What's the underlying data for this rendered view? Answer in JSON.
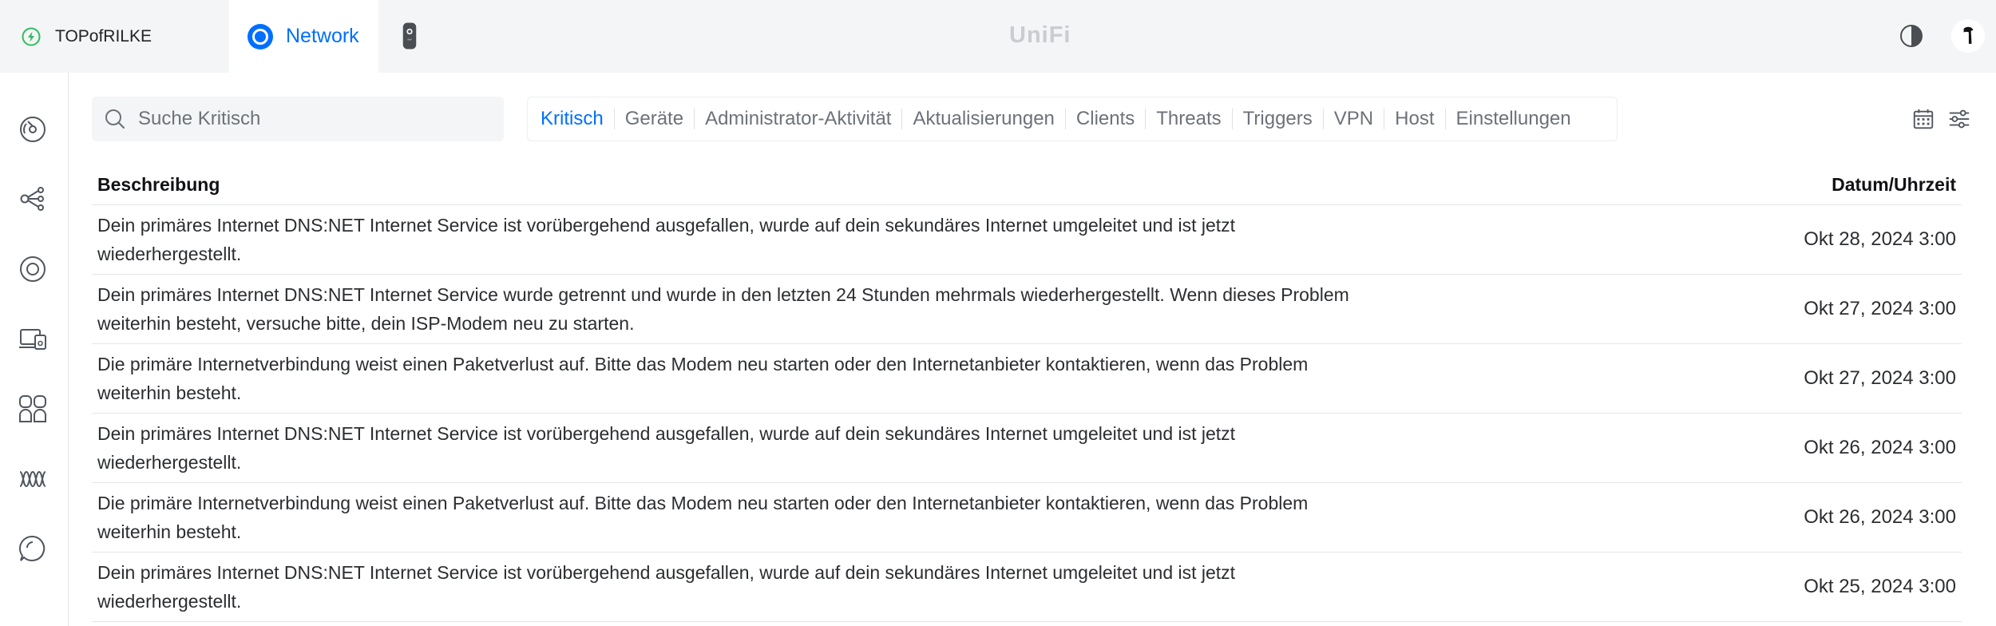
{
  "topbar": {
    "site_name": "TOPofRILKE",
    "app_name": "Network",
    "brand": "UniFi",
    "site_icon": "lightning-circle-icon",
    "app_icon": "network-ring-icon",
    "device_icon": "device-icon",
    "theme_icon": "half-circle-theme-icon",
    "avatar_icon": "user-avatar-icon"
  },
  "sidebar": {
    "items": [
      {
        "icon": "dashboard-icon"
      },
      {
        "icon": "topology-icon"
      },
      {
        "icon": "wifi-icon"
      },
      {
        "icon": "devices-icon"
      },
      {
        "icon": "clients-icon"
      },
      {
        "icon": "insights-icon"
      },
      {
        "icon": "integrations-icon"
      }
    ]
  },
  "toolbar": {
    "search_placeholder": "Suche Kritisch",
    "filters": [
      "Kritisch",
      "Geräte",
      "Administrator-Aktivität",
      "Aktualisierungen",
      "Clients",
      "Threats",
      "Triggers",
      "VPN",
      "Host",
      "Einstellungen"
    ],
    "active_filter": "Kritisch",
    "calendar_icon": "calendar-icon",
    "settings_icon": "sliders-icon"
  },
  "table": {
    "headers": {
      "description": "Beschreibung",
      "datetime": "Datum/Uhrzeit"
    },
    "rows": [
      {
        "description": "Dein primäres Internet DNS:NET Internet Service ist vorübergehend ausgefallen, wurde auf dein sekundäres Internet umgeleitet und ist jetzt wiederhergestellt.",
        "datetime": "Okt 28, 2024 3:00"
      },
      {
        "description": "Dein primäres Internet DNS:NET Internet Service wurde getrennt und wurde in den letzten 24 Stunden mehrmals wiederhergestellt. Wenn dieses Problem weiterhin besteht, versuche bitte, dein ISP-Modem neu zu starten.",
        "datetime": "Okt 27, 2024 3:00"
      },
      {
        "description": "Die primäre Internetverbindung weist einen Paketverlust auf. Bitte das Modem neu starten oder den Internetanbieter kontaktieren, wenn das Problem weiterhin besteht.",
        "datetime": "Okt 27, 2024 3:00"
      },
      {
        "description": "Dein primäres Internet DNS:NET Internet Service ist vorübergehend ausgefallen, wurde auf dein sekundäres Internet umgeleitet und ist jetzt wiederhergestellt.",
        "datetime": "Okt 26, 2024 3:00"
      },
      {
        "description": "Die primäre Internetverbindung weist einen Paketverlust auf. Bitte das Modem neu starten oder den Internetanbieter kontaktieren, wenn das Problem weiterhin besteht.",
        "datetime": "Okt 26, 2024 3:00"
      },
      {
        "description": "Dein primäres Internet DNS:NET Internet Service ist vorübergehend ausgefallen, wurde auf dein sekundäres Internet umgeleitet und ist jetzt wiederhergestellt.",
        "datetime": "Okt 25, 2024 3:00"
      }
    ]
  },
  "colors": {
    "accent": "#006fff",
    "site_status": "#2ebd5f",
    "topbar_bg": "#f4f5f6",
    "muted_text": "#6d7279"
  }
}
